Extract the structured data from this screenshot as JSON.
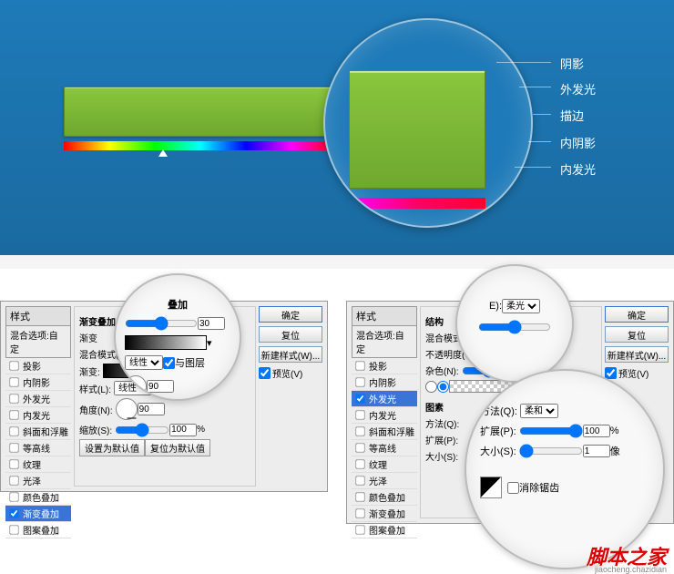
{
  "annotations": {
    "a1": "阴影",
    "a2": "外发光",
    "a3": "描边",
    "a4": "内阴影",
    "a5": "内发光"
  },
  "stylesPanel": {
    "title": "样式",
    "customLabel": "混合选项:自定",
    "items": [
      "投影",
      "内阴影",
      "外发光",
      "内发光",
      "斜面和浮雕",
      "等高线",
      "纹理",
      "光泽",
      "颜色叠加",
      "渐变叠加",
      "图案叠加"
    ],
    "selectedLeftIndex": 9,
    "checkedLeft": [
      9
    ],
    "selectedRightIndex": 2,
    "checkedRight": [
      2
    ]
  },
  "buttons": {
    "ok": "确定",
    "cancel": "复位",
    "newStyle": "新建样式(W)...",
    "preview": "预览(V)",
    "defaults": "设置为默认值",
    "resetDefaults": "复位为默认值"
  },
  "gradientOverlay": {
    "section": "渐变叠加",
    "gradientLabel": "渐变",
    "blendModeLabel": "混合模式(O):",
    "gradientRowLabel": "渐变:",
    "styleLabel": "样式(L):",
    "styleValue": "线性",
    "alignLabel": "与图层",
    "angleLabel": "角度(N):",
    "angleValue": "90",
    "scaleLabel": "缩放(S):",
    "scaleValue": "100",
    "percent": "%"
  },
  "lens1": {
    "title": "叠加",
    "opacityValue": "30"
  },
  "outerGlow": {
    "section": "结构",
    "blendModeLabel": "混合模式(E):",
    "opacityLabel": "不透明度(O):",
    "noiseLabel": "杂色(N):",
    "elementsLabel": "图素",
    "techniqueLabel": "方法(Q):",
    "spreadLabel": "扩展(P):",
    "sizeLabel": "大小(S):",
    "antialias": "消除锯齿"
  },
  "lens2": {
    "modeLabel": "E):",
    "modeValue": "柔光"
  },
  "lens3": {
    "techLabel": "方法(Q):",
    "techValue": "柔和",
    "spreadLabel": "扩展(P):",
    "spreadValue": "100",
    "sizeLabel": "大小(S):",
    "sizeValue": "1",
    "pct": "%",
    "px": "像"
  },
  "watermark": {
    "main": "脚本之家",
    "sub": "jiaocheng.chazidian"
  }
}
